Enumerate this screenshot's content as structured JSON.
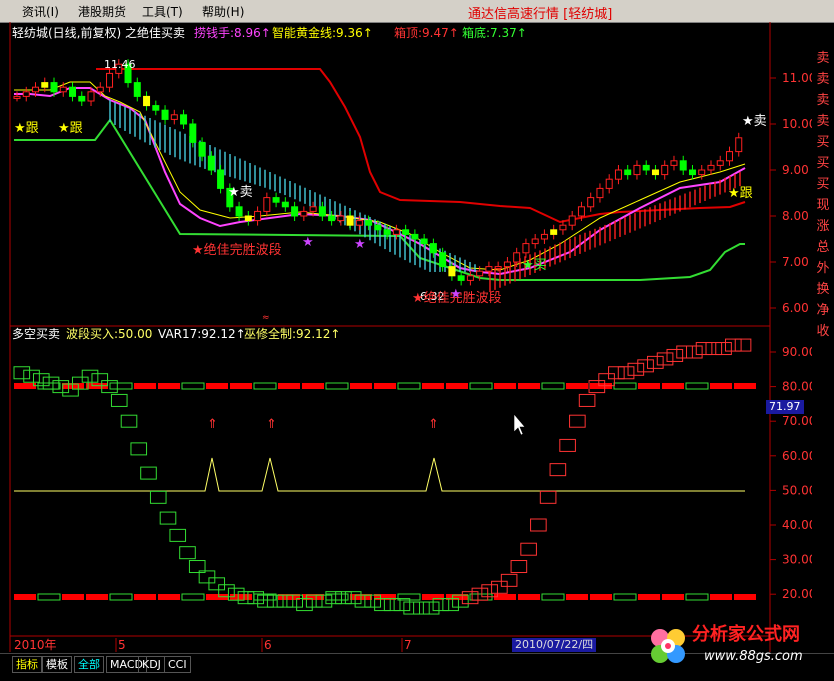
{
  "menubar": {
    "items": [
      {
        "label": "资讯(I)"
      },
      {
        "label": "港股期货"
      },
      {
        "label": "工具(T)"
      },
      {
        "label": "帮助(H)"
      }
    ],
    "app_title": "通达信高速行情 [轻纺城]"
  },
  "main_chart": {
    "title": "轻纺城(日线,前复权) 之绝佳买卖",
    "indicators": [
      {
        "label": "捞钱手:8.96↑",
        "color": "#ff44ff"
      },
      {
        "label": "智能黄金线:9.36↑",
        "color": "#ffff00"
      },
      {
        "label": "箱顶:9.47↑",
        "color": "#ff3333"
      },
      {
        "label": "箱底:7.37↑",
        "color": "#33ff33"
      }
    ],
    "price_ticks": [
      "11.00",
      "10.00",
      "9.00",
      "8.00",
      "7.00",
      "6.00"
    ],
    "annotations": {
      "high_label": "11.46",
      "low_label": "6.32",
      "follow1": "★跟",
      "follow2": "★跟",
      "follow3": "★跟",
      "sell1": "★卖",
      "sell2": "★卖",
      "buy": "★买",
      "wave1": "★绝佳完胜波段",
      "wave2": "★绝佳完胜波段"
    }
  },
  "sub_chart": {
    "title": "多空买卖",
    "indicators": [
      {
        "label": "波段买入:50.00",
        "color": "#ffff66"
      },
      {
        "label": "VAR17:92.12↑",
        "color": "#ffffff"
      },
      {
        "label": "巫修全制:92.12↑",
        "color": "#ffff66"
      }
    ],
    "ticks": [
      "90.00",
      "80.00",
      "70.00",
      "60.00",
      "50.00",
      "40.00",
      "30.00",
      "20.00"
    ],
    "current_value": "71.97"
  },
  "time_axis": {
    "labels": [
      "2010年",
      "5",
      "6",
      "7"
    ],
    "cursor_date": "2010/07/22/四"
  },
  "sidebar": {
    "items": [
      {
        "label": "卖",
        "color": "#ff4444"
      },
      {
        "label": "卖",
        "color": "#ff4444"
      },
      {
        "label": "卖",
        "color": "#ff4444"
      },
      {
        "label": "卖",
        "color": "#ff4444"
      },
      {
        "label": "买",
        "color": "#ff4444"
      },
      {
        "label": "买",
        "color": "#ff4444"
      },
      {
        "label": "买",
        "color": "#ff4444"
      },
      {
        "label": "现",
        "color": "#ff4444"
      },
      {
        "label": "涨",
        "color": "#ff4444"
      },
      {
        "label": "总",
        "color": "#ff4444"
      },
      {
        "label": "外",
        "color": "#ff4444"
      },
      {
        "label": "换",
        "color": "#ff4444"
      },
      {
        "label": "净",
        "color": "#ff4444"
      },
      {
        "label": "收",
        "color": "#ff4444"
      }
    ]
  },
  "bottom_tabs": [
    {
      "label": "指标",
      "color": "#ffff00"
    },
    {
      "label": "模板",
      "color": "#ffffff"
    },
    {
      "label": "全部",
      "color": "#00ffff"
    },
    {
      "label": "MACD",
      "color": "#ffffff"
    },
    {
      "label": "KDJ",
      "color": "#ffffff"
    },
    {
      "label": "CCI",
      "color": "#ffffff"
    }
  ],
  "watermark": {
    "text": "分析家公式网",
    "url": "www.88gs.com"
  },
  "colors": {
    "up": "#ff2020",
    "down": "#00ff00",
    "box_top": "#e00000",
    "box_bottom": "#33dd33",
    "golden_line": "#ffff00",
    "money_line": "#ff44ff",
    "axis": "#b00000"
  }
}
